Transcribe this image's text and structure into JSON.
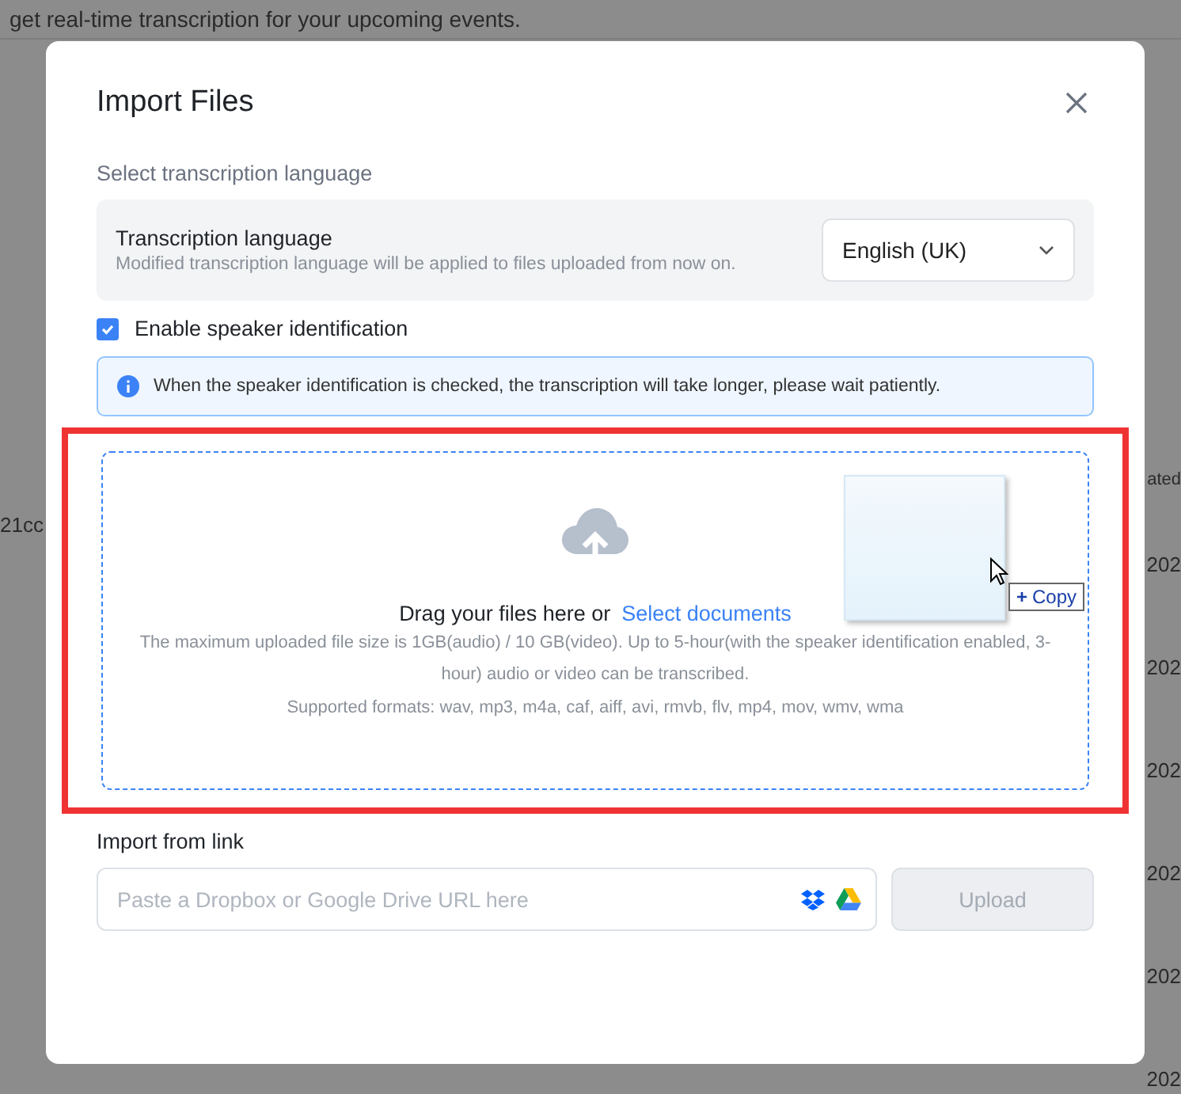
{
  "background": {
    "banner_text": "get real-time transcription for your upcoming events.",
    "left_cell": "21cc",
    "column_header": "ated",
    "dates": [
      "202",
      "202",
      "202",
      "202",
      "202",
      "202"
    ]
  },
  "dialog": {
    "title": "Import Files",
    "section_label": "Select transcription language",
    "language": {
      "title": "Transcription language",
      "description": "Modified transcription language will be applied to files uploaded from now on.",
      "value": "English (UK)"
    },
    "speaker_identification": {
      "label": "Enable speaker identification",
      "checked": true
    },
    "notice": "When the speaker identification is checked, the transcription will take longer, please wait patiently.",
    "dropzone": {
      "highlighted": true,
      "prompt": "Drag your files here or",
      "link": "Select documents",
      "limits": "The maximum uploaded file size is 1GB(audio) / 10 GB(video). Up to 5-hour(with the speaker identification enabled, 3-hour) audio or video can be transcribed.",
      "formats": "Supported formats: wav, mp3, m4a, caf, aiff, avi, rmvb, flv, mp4, mov, wmv, wma",
      "drag_icon": "+",
      "drag_label": "Copy"
    },
    "link_import": {
      "label": "Import from link",
      "placeholder": "Paste a Dropbox or Google Drive URL here",
      "button": "Upload",
      "button_disabled": true
    }
  }
}
